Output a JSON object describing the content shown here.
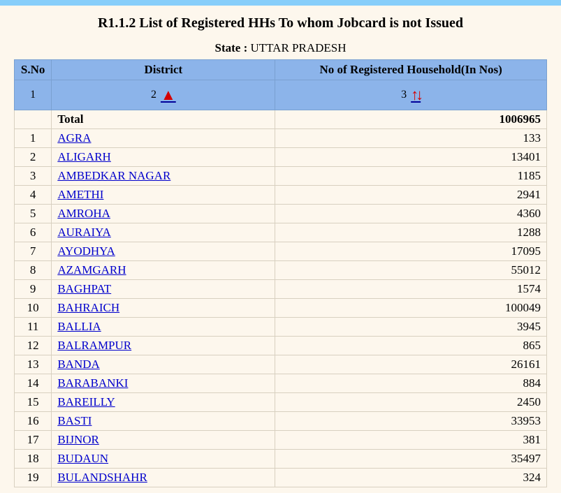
{
  "title": "R1.1.2 List of Registered HHs To whom Jobcard is not Issued",
  "state_label": "State : ",
  "state_value": "UTTAR PRADESH",
  "columns": {
    "sno": "S.No",
    "district": "District",
    "hh": "No of Registered Household(In Nos)"
  },
  "sortrow": {
    "sno": "1",
    "dist": "2",
    "hh": "3"
  },
  "total_label": "Total",
  "total_value": "1006965",
  "rows": [
    {
      "sno": "1",
      "district": "AGRA",
      "hh": "133"
    },
    {
      "sno": "2",
      "district": "ALIGARH",
      "hh": "13401"
    },
    {
      "sno": "3",
      "district": "AMBEDKAR NAGAR",
      "hh": "1185"
    },
    {
      "sno": "4",
      "district": "AMETHI",
      "hh": "2941"
    },
    {
      "sno": "5",
      "district": "AMROHA",
      "hh": "4360"
    },
    {
      "sno": "6",
      "district": "AURAIYA",
      "hh": "1288"
    },
    {
      "sno": "7",
      "district": "AYODHYA",
      "hh": "17095"
    },
    {
      "sno": "8",
      "district": "AZAMGARH",
      "hh": "55012"
    },
    {
      "sno": "9",
      "district": "BAGHPAT",
      "hh": "1574"
    },
    {
      "sno": "10",
      "district": "BAHRAICH",
      "hh": "100049"
    },
    {
      "sno": "11",
      "district": "BALLIA",
      "hh": "3945"
    },
    {
      "sno": "12",
      "district": "BALRAMPUR",
      "hh": "865"
    },
    {
      "sno": "13",
      "district": "BANDA",
      "hh": "26161"
    },
    {
      "sno": "14",
      "district": "BARABANKI",
      "hh": "884"
    },
    {
      "sno": "15",
      "district": "BAREILLY",
      "hh": "2450"
    },
    {
      "sno": "16",
      "district": "BASTI",
      "hh": "33953"
    },
    {
      "sno": "17",
      "district": "BIJNOR",
      "hh": "381"
    },
    {
      "sno": "18",
      "district": "BUDAUN",
      "hh": "35497"
    },
    {
      "sno": "19",
      "district": "BULANDSHAHR",
      "hh": "324"
    }
  ],
  "chart_data": {
    "type": "table",
    "title": "R1.1.2 List of Registered HHs To whom Jobcard is not Issued — UTTAR PRADESH",
    "columns": [
      "S.No",
      "District",
      "No of Registered Household(In Nos)"
    ],
    "total": 1006965,
    "data": [
      [
        1,
        "AGRA",
        133
      ],
      [
        2,
        "ALIGARH",
        13401
      ],
      [
        3,
        "AMBEDKAR NAGAR",
        1185
      ],
      [
        4,
        "AMETHI",
        2941
      ],
      [
        5,
        "AMROHA",
        4360
      ],
      [
        6,
        "AURAIYA",
        1288
      ],
      [
        7,
        "AYODHYA",
        17095
      ],
      [
        8,
        "AZAMGARH",
        55012
      ],
      [
        9,
        "BAGHPAT",
        1574
      ],
      [
        10,
        "BAHRAICH",
        100049
      ],
      [
        11,
        "BALLIA",
        3945
      ],
      [
        12,
        "BALRAMPUR",
        865
      ],
      [
        13,
        "BANDA",
        26161
      ],
      [
        14,
        "BARABANKI",
        884
      ],
      [
        15,
        "BAREILLY",
        2450
      ],
      [
        16,
        "BASTI",
        33953
      ],
      [
        17,
        "BIJNOR",
        381
      ],
      [
        18,
        "BUDAUN",
        35497
      ],
      [
        19,
        "BULANDSHAHR",
        324
      ]
    ]
  }
}
